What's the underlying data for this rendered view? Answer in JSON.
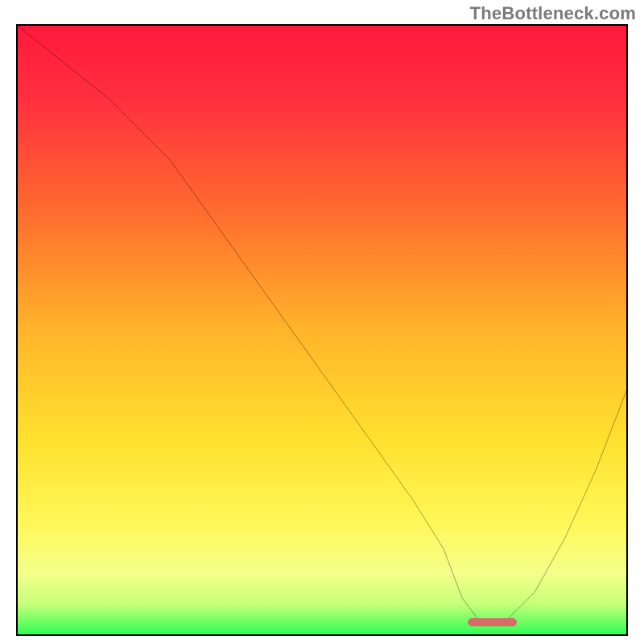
{
  "watermark": "TheBottleneck.com",
  "chart_data": {
    "type": "line",
    "title": "",
    "xlabel": "",
    "ylabel": "",
    "xlim": [
      0,
      100
    ],
    "ylim": [
      0,
      100
    ],
    "x": [
      0,
      5,
      10,
      15,
      20,
      25,
      30,
      35,
      40,
      45,
      50,
      55,
      60,
      65,
      70,
      73,
      76,
      80,
      85,
      90,
      95,
      100
    ],
    "y": [
      100,
      96,
      92,
      88,
      83,
      78,
      71,
      64,
      57,
      50,
      43,
      36,
      29,
      22,
      14,
      6,
      2,
      2,
      7,
      16,
      27,
      40
    ],
    "optimum_marker": {
      "x_start": 74,
      "x_end": 82,
      "y": 2
    },
    "gradient_stops": [
      {
        "pos": 0.0,
        "color": "#ff1a3c"
      },
      {
        "pos": 0.12,
        "color": "#ff2f3f"
      },
      {
        "pos": 0.3,
        "color": "#ff6a2e"
      },
      {
        "pos": 0.5,
        "color": "#ffb42a"
      },
      {
        "pos": 0.68,
        "color": "#ffe12e"
      },
      {
        "pos": 0.82,
        "color": "#fff85a"
      },
      {
        "pos": 0.9,
        "color": "#f4ff8a"
      },
      {
        "pos": 0.95,
        "color": "#c6ff7a"
      },
      {
        "pos": 0.975,
        "color": "#7dff66"
      },
      {
        "pos": 1.0,
        "color": "#2cff55"
      }
    ]
  }
}
